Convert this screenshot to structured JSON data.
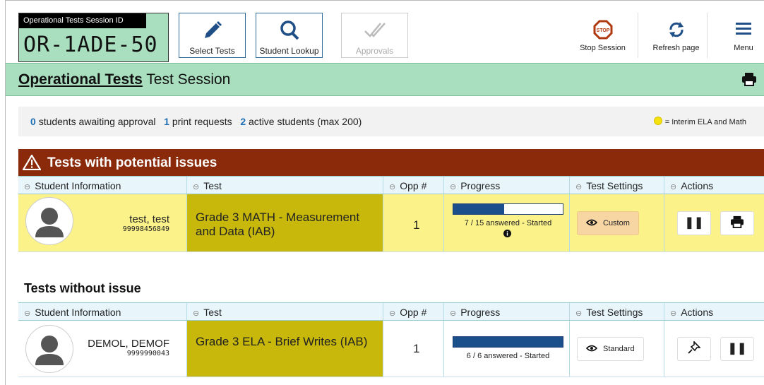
{
  "session": {
    "label": "Operational Tests  Session ID",
    "id": "OR-1ADE-50"
  },
  "toolbar": {
    "select_tests": "Select Tests",
    "student_lookup": "Student Lookup",
    "approvals": "Approvals",
    "stop_session": "Stop Session",
    "refresh_page": "Refresh page",
    "menu": "Menu",
    "stop_sign_text": "STOP"
  },
  "title": {
    "bold": "Operational Tests",
    "rest": "Test Session"
  },
  "status": {
    "awaiting_count": "0",
    "awaiting_text": "students awaiting approval",
    "print_count": "1",
    "print_text": "print requests",
    "active_count": "2",
    "active_text": "active students  (max 200)",
    "legend_text": "= Interim ELA and Math"
  },
  "issues_header": "Tests with potential issues",
  "no_issues_header": "Tests without issue",
  "columns": [
    "Student Information",
    "Test",
    "Opp #",
    "Progress",
    "Test Settings",
    "Actions"
  ],
  "issue_rows": [
    {
      "name": "test, test",
      "id": "99998456849",
      "test": "Grade 3 MATH - Measurement and Data (IAB)",
      "opp": "1",
      "progress_text": "7 / 15 answered  -  Started",
      "progress_fraction": 0.467,
      "settings": "Custom"
    }
  ],
  "ok_rows": [
    {
      "name": "DEMOL, DEMOF",
      "id": "9999990043",
      "test": "Grade 3 ELA - Brief Writes (IAB)",
      "opp": "1",
      "progress_text": "6 / 6 answered  -  Started",
      "progress_fraction": 1.0,
      "settings": "Standard"
    }
  ],
  "colors": {
    "green": "#a9dfbf",
    "issue_red": "#8b2a0b",
    "highlight_yellow": "#fbf28a",
    "test_olive": "#c7b80b",
    "progress_blue": "#1b4f8c",
    "link_blue": "#1e6fb5"
  },
  "icons": [
    "pencil-icon",
    "search-icon",
    "double-check-icon",
    "stop-sign-icon",
    "refresh-icon",
    "hamburger-icon",
    "printer-icon",
    "warning-icon",
    "eye-icon",
    "pause-icon",
    "pin-icon",
    "info-icon",
    "sort-icon",
    "avatar-icon"
  ]
}
